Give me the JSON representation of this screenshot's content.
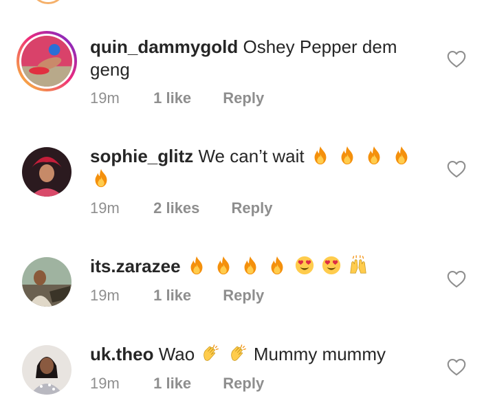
{
  "comments": [
    {
      "username": "quin_dammygold",
      "text_before": "Oshey Pepper dem geng",
      "emojis": [],
      "text_after": "",
      "time": "19m",
      "likes": "1 like",
      "reply": "Reply",
      "avatar_icon": "avatar-photo-icon",
      "has_story_ring": true
    },
    {
      "username": "sophie_glitz",
      "text_before": "We can’t wait",
      "emojis": [
        "fire",
        "fire",
        "fire",
        "fire",
        "fire"
      ],
      "text_after": "",
      "time": "19m",
      "likes": "2 likes",
      "reply": "Reply",
      "avatar_icon": "avatar-photo-icon",
      "has_story_ring": false
    },
    {
      "username": "its.zarazee",
      "text_before": "",
      "emojis": [
        "fire",
        "fire",
        "fire",
        "fire",
        "heart-eyes",
        "heart-eyes",
        "raising-hands"
      ],
      "text_after": "",
      "time": "19m",
      "likes": "1 like",
      "reply": "Reply",
      "avatar_icon": "avatar-photo-icon",
      "has_story_ring": false
    },
    {
      "username": "uk.theo",
      "text_before": "Wao",
      "emojis": [
        "clapping-hands",
        "clapping-hands"
      ],
      "text_after": "Mummy mummy",
      "time": "19m",
      "likes": "1 like",
      "reply": "Reply",
      "avatar_icon": "avatar-photo-icon",
      "has_story_ring": false
    }
  ],
  "icons": {
    "like": "heart-outline-icon"
  },
  "colors": {
    "text": "#262626",
    "meta": "#8e8e8e",
    "story_ring_start": "#f9ce34",
    "story_ring_end": "#6228d7"
  }
}
